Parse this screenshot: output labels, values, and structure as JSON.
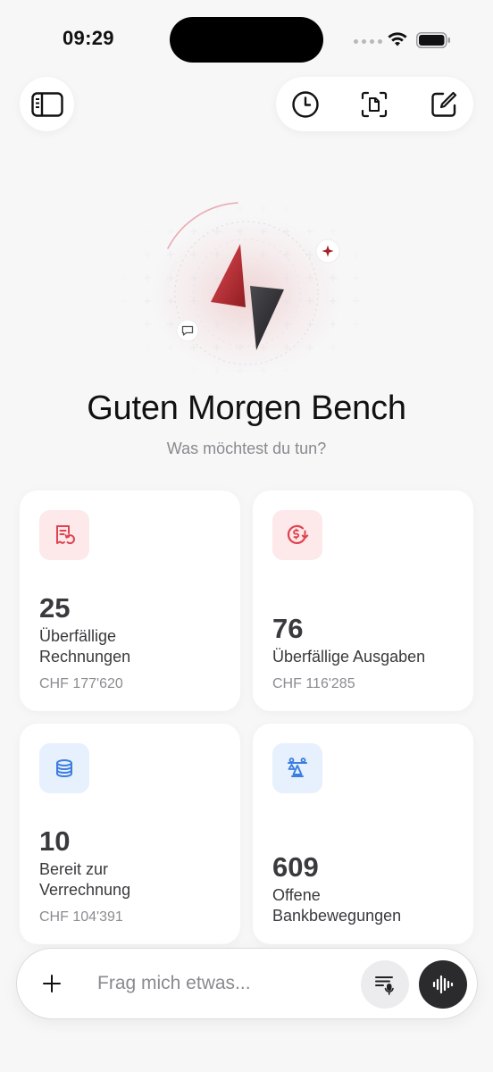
{
  "status_bar": {
    "time": "09:29"
  },
  "hero": {
    "greeting": "Guten Morgen Bench",
    "subtitle": "Was möchtest du tun?"
  },
  "cards": [
    {
      "count": "25",
      "label_line1": "Überfällige",
      "label_line2": "Rechnungen",
      "amount": "CHF 177'620",
      "icon": "invoice-icon",
      "accent": "#e0424f"
    },
    {
      "count": "76",
      "label_line1": "Überfällige Ausgaben",
      "amount": "CHF 116'285",
      "icon": "expense-due-icon",
      "accent": "#e0424f"
    },
    {
      "count": "10",
      "label_line1": "Bereit zur",
      "label_line2": "Verrechnung",
      "amount": "CHF 104'391",
      "icon": "coin-stack-icon",
      "accent": "#3b7de0"
    },
    {
      "count": "609",
      "label_line1": "Offene",
      "label_line2": "Bankbewegungen",
      "icon": "reconcile-scale-icon",
      "accent": "#3b7de0"
    }
  ],
  "input": {
    "placeholder": "Frag mich etwas..."
  },
  "colors": {
    "background": "#f7f7f8",
    "card": "#ffffff",
    "red_tint": "#fde8ea",
    "blue_tint": "#e7f0fd",
    "voice_button": "#2b2b2e"
  }
}
